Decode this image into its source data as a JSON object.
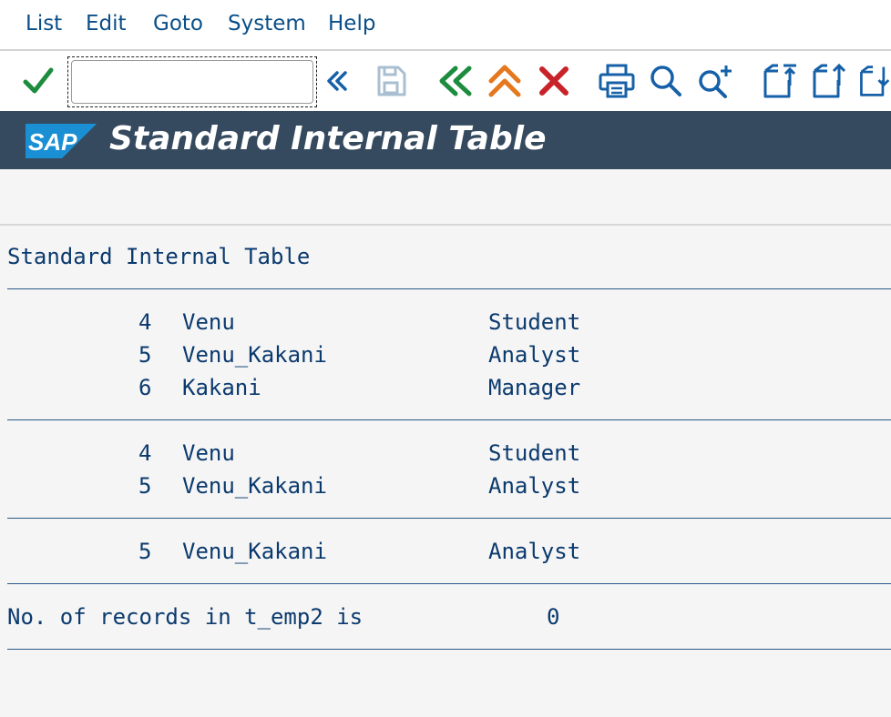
{
  "menu": {
    "items": [
      {
        "label": "List"
      },
      {
        "label": "Edit"
      },
      {
        "label": "Goto"
      },
      {
        "label": "System"
      },
      {
        "label": "Help"
      }
    ]
  },
  "toolbar": {
    "command_field_value": "",
    "icons": [
      "check-icon",
      "expand-icon",
      "save-icon",
      "back-icon",
      "exit-icon",
      "cancel-icon",
      "print-icon",
      "find-icon",
      "find-next-icon",
      "first-page-icon",
      "previous-page-icon",
      "next-page-icon"
    ]
  },
  "titlebar": {
    "logo_text": "SAP",
    "title": "Standard Internal Table"
  },
  "colors": {
    "titlebar_bg": "#354a5f",
    "menu_text": "#0a4f88",
    "list_text": "#0b3a6e",
    "check_green": "#1e8c3e",
    "up_orange": "#e5781e",
    "cancel_red": "#c8232a"
  },
  "report": {
    "heading": "Standard Internal Table",
    "blocks": [
      [
        {
          "id": "4",
          "name": "Venu",
          "role": "Student"
        },
        {
          "id": "5",
          "name": "Venu_Kakani",
          "role": "Analyst"
        },
        {
          "id": "6",
          "name": "Kakani",
          "role": "Manager"
        }
      ],
      [
        {
          "id": "4",
          "name": "Venu",
          "role": "Student"
        },
        {
          "id": "5",
          "name": "Venu_Kakani",
          "role": "Analyst"
        }
      ],
      [
        {
          "id": "5",
          "name": "Venu_Kakani",
          "role": "Analyst"
        }
      ]
    ],
    "summary_label": "No. of records in t_emp2 is",
    "summary_value": "0"
  }
}
